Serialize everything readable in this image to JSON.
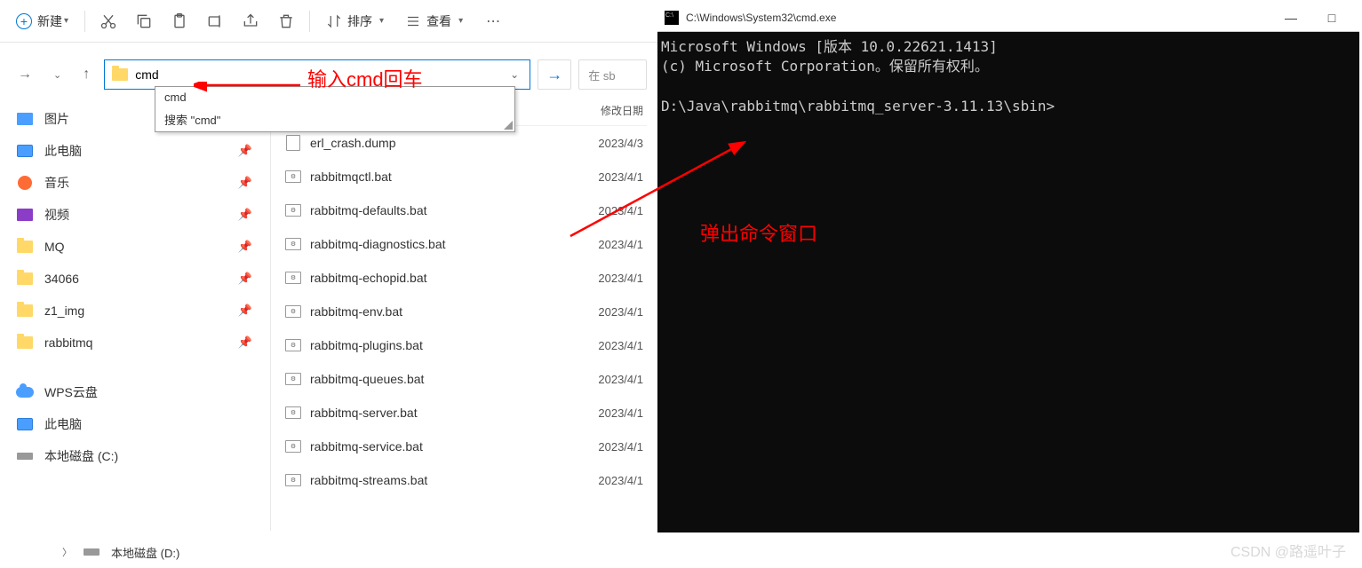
{
  "toolbar": {
    "new_label": "新建",
    "sort_label": "排序",
    "view_label": "查看"
  },
  "address": {
    "value": "cmd",
    "search_placeholder": "在 sb"
  },
  "autocomplete": {
    "items": [
      "cmd",
      "搜索 \"cmd\""
    ]
  },
  "sidebar": {
    "items": [
      {
        "label": "图片",
        "kind": "img",
        "pin": true
      },
      {
        "label": "此电脑",
        "kind": "pc",
        "pin": true
      },
      {
        "label": "音乐",
        "kind": "music",
        "pin": true
      },
      {
        "label": "视频",
        "kind": "video",
        "pin": true
      },
      {
        "label": "MQ",
        "kind": "folder",
        "pin": true
      },
      {
        "label": "34066",
        "kind": "folder",
        "pin": true
      },
      {
        "label": "z1_img",
        "kind": "folder",
        "pin": true
      },
      {
        "label": "rabbitmq",
        "kind": "folder",
        "pin": true
      }
    ],
    "items2": [
      {
        "label": "WPS云盘",
        "kind": "cloud"
      },
      {
        "label": "此电脑",
        "kind": "pc"
      },
      {
        "label": "本地磁盘 (C:)",
        "kind": "disk"
      }
    ]
  },
  "filelist": {
    "header_date": "修改日期",
    "rows": [
      {
        "name": "erl_crash.dump",
        "date": "2023/4/3",
        "kind": "file"
      },
      {
        "name": "rabbitmqctl.bat",
        "date": "2023/4/1",
        "kind": "bat"
      },
      {
        "name": "rabbitmq-defaults.bat",
        "date": "2023/4/1",
        "kind": "bat"
      },
      {
        "name": "rabbitmq-diagnostics.bat",
        "date": "2023/4/1",
        "kind": "bat"
      },
      {
        "name": "rabbitmq-echopid.bat",
        "date": "2023/4/1",
        "kind": "bat"
      },
      {
        "name": "rabbitmq-env.bat",
        "date": "2023/4/1",
        "kind": "bat"
      },
      {
        "name": "rabbitmq-plugins.bat",
        "date": "2023/4/1",
        "kind": "bat"
      },
      {
        "name": "rabbitmq-queues.bat",
        "date": "2023/4/1",
        "kind": "bat"
      },
      {
        "name": "rabbitmq-server.bat",
        "date": "2023/4/1",
        "kind": "bat"
      },
      {
        "name": "rabbitmq-service.bat",
        "date": "2023/4/1",
        "kind": "bat"
      },
      {
        "name": "rabbitmq-streams.bat",
        "date": "2023/4/1",
        "kind": "bat"
      }
    ]
  },
  "tree": {
    "disk_d": "本地磁盘 (D:)"
  },
  "annotations": {
    "a1": "输入cmd回车",
    "a2": "弹出命令窗口"
  },
  "cmd": {
    "title": "C:\\Windows\\System32\\cmd.exe",
    "lines": "Microsoft Windows [版本 10.0.22621.1413]\n(c) Microsoft Corporation。保留所有权利。\n\nD:\\Java\\rabbitmq\\rabbitmq_server-3.11.13\\sbin>"
  },
  "watermark": "CSDN @路遥叶子"
}
